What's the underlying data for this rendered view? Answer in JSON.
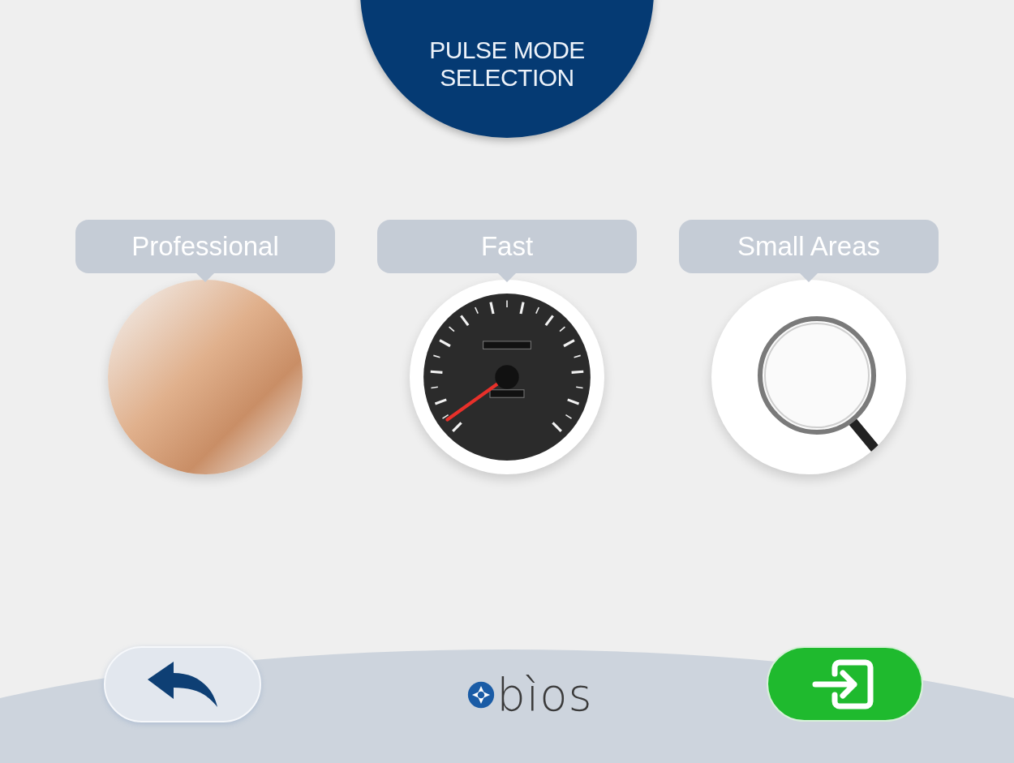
{
  "header": {
    "title_lines": [
      "PULSE MODE",
      "SELECTION"
    ]
  },
  "modes": [
    {
      "label": "Professional",
      "kind": "photo"
    },
    {
      "label": "Fast",
      "kind": "speedometer"
    },
    {
      "label": "Small Areas",
      "kind": "magnifier"
    }
  ],
  "footer": {
    "logo_text": "bìos"
  }
}
